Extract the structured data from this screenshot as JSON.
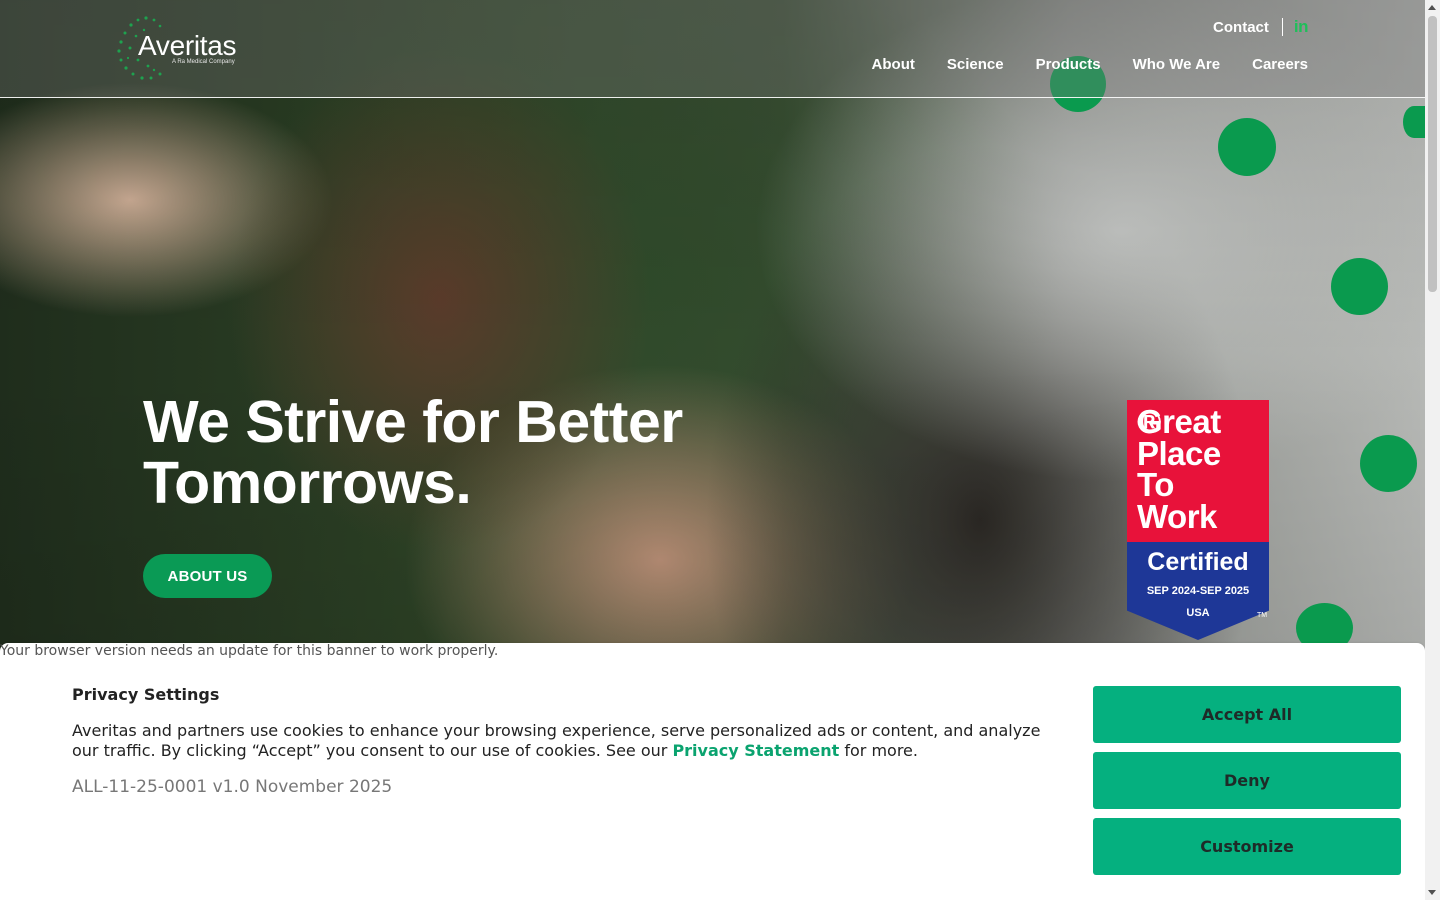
{
  "brand": {
    "name": "Averitas",
    "tagline": "A Ra Medical Company",
    "accent_color": "#0a9a55"
  },
  "utility_nav": {
    "contact_label": "Contact",
    "linkedin_label": "in",
    "linkedin_icon": "linkedin-icon"
  },
  "main_nav": {
    "items": [
      "About",
      "Science",
      "Products",
      "Who We Are",
      "Careers"
    ]
  },
  "hero": {
    "headline": "We Strive for Better Tomorrows.",
    "cta_label": "ABOUT US"
  },
  "badge": {
    "line1": "Great\nPlace\nTo\nWork",
    "registered_mark": "®",
    "certified_label": "Certified",
    "dates": "SEP 2024-SEP 2025",
    "country": "USA",
    "trademark": "TM",
    "red_color": "#e8123a",
    "blue_color": "#1e3797"
  },
  "cookie_banner": {
    "warning": "Your browser version needs an update for this banner to work properly.",
    "title": "Privacy Settings",
    "text_before": "Averitas and partners use cookies to enhance your browsing experience, serve personalized ads or content, and analyze our traffic. By clicking “Accept” you consent to our use of cookies. See our ",
    "link_label": "Privacy Statement",
    "text_after": " for more.",
    "version": "ALL-11-25-0001 v1.0 November 2025",
    "buttons": {
      "accept": "Accept All",
      "deny": "Deny",
      "customize": "Customize"
    },
    "button_color": "#05b07f"
  }
}
